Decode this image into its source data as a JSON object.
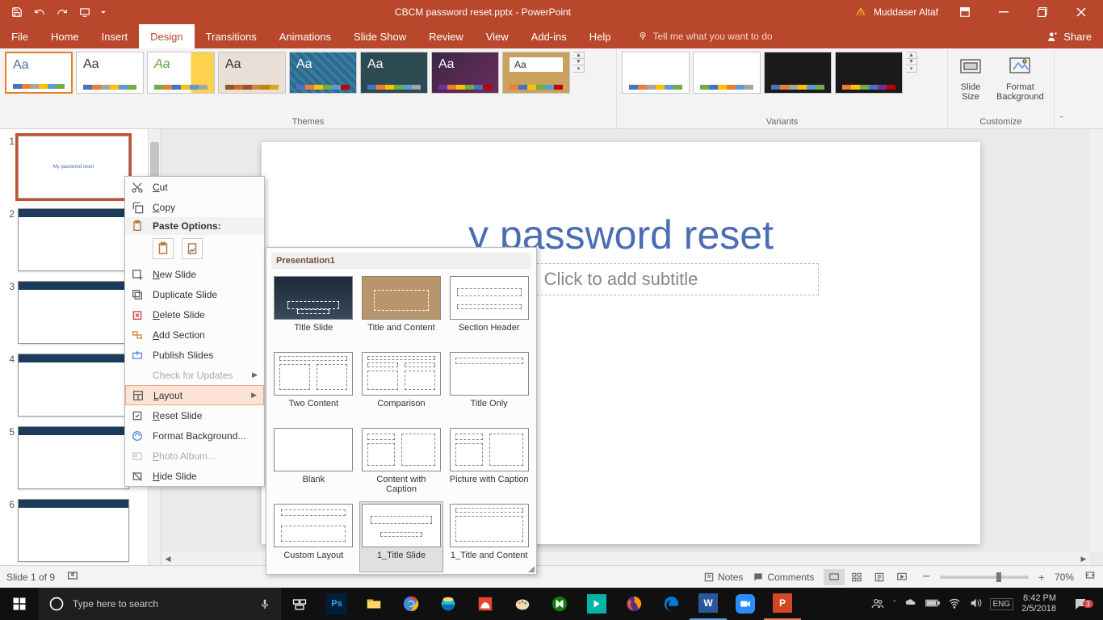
{
  "titlebar": {
    "document_title": "CBCM password reset.pptx - PowerPoint",
    "user_name": "Muddaser Altaf"
  },
  "ribbon_tabs": {
    "file": "File",
    "home": "Home",
    "insert": "Insert",
    "design": "Design",
    "transitions": "Transitions",
    "animations": "Animations",
    "slideshow": "Slide Show",
    "review": "Review",
    "view": "View",
    "addins": "Add-ins",
    "help": "Help",
    "tellme": "Tell me what you want to do",
    "share": "Share"
  },
  "ribbon_groups": {
    "themes": "Themes",
    "variants": "Variants",
    "customize": "Customize",
    "slide_size": "Slide\nSize",
    "format_bg": "Format\nBackground"
  },
  "slide_panel": {
    "numbers": [
      "1",
      "2",
      "3",
      "4",
      "5",
      "6"
    ],
    "slide1_text": "My password reset"
  },
  "canvas": {
    "title": "y password reset",
    "subtitle_placeholder": "Click to add subtitle"
  },
  "context_menu": {
    "cut": "Cut",
    "copy": "Copy",
    "paste_header": "Paste Options:",
    "new_slide": "New Slide",
    "duplicate": "Duplicate Slide",
    "delete": "Delete Slide",
    "add_section": "Add Section",
    "publish": "Publish Slides",
    "check_updates": "Check for Updates",
    "layout": "Layout",
    "reset": "Reset Slide",
    "format_bg": "Format Background...",
    "photo_album": "Photo Album...",
    "hide": "Hide Slide"
  },
  "layout_flyout": {
    "header": "Presentation1",
    "items": [
      "Title Slide",
      "Title and Content",
      "Section Header",
      "Two Content",
      "Comparison",
      "Title Only",
      "Blank",
      "Content with Caption",
      "Picture with Caption",
      "Custom Layout",
      "1_Title Slide",
      "1_Title and Content"
    ]
  },
  "statusbar": {
    "slide_info": "Slide 1 of 9",
    "notes": "Notes",
    "comments": "Comments",
    "zoom_pct": "70%"
  },
  "taskbar": {
    "search_placeholder": "Type here to search",
    "time": "8:42 PM",
    "date": "2/5/2018",
    "notif_count": "3"
  }
}
